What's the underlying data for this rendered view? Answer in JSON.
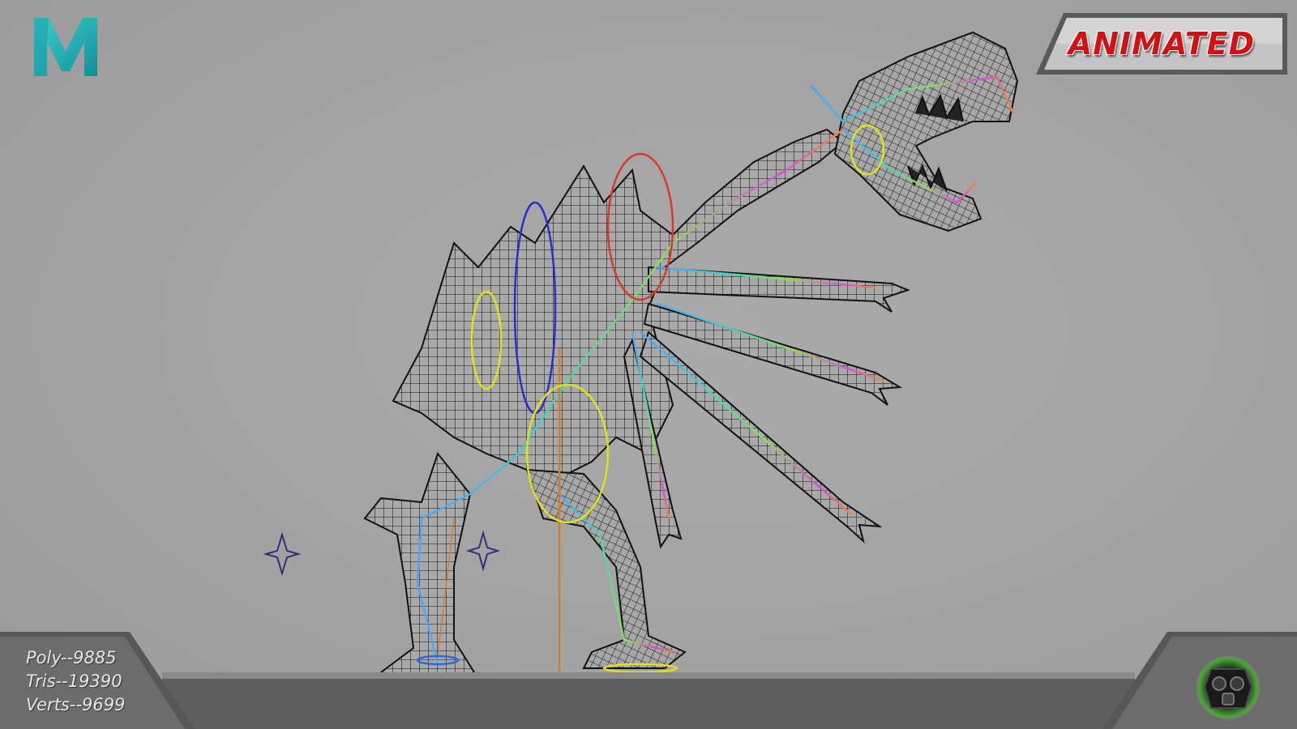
{
  "badge": {
    "label": "ANIMATED",
    "text_color": "#d21212"
  },
  "stats": {
    "poly": "Poly--9885",
    "tris": "Tris--19390",
    "verts": "Verts--9699"
  },
  "icons": {
    "app_logo": "maya-logo-icon",
    "brand_logo": "gas-mask-logo-icon"
  },
  "colors": {
    "viewport_bg": "#a3a3a3",
    "logo_teal": "#2ab5b8",
    "footer_gray": "#6a6a6a",
    "mesh_dark": "#111111"
  }
}
